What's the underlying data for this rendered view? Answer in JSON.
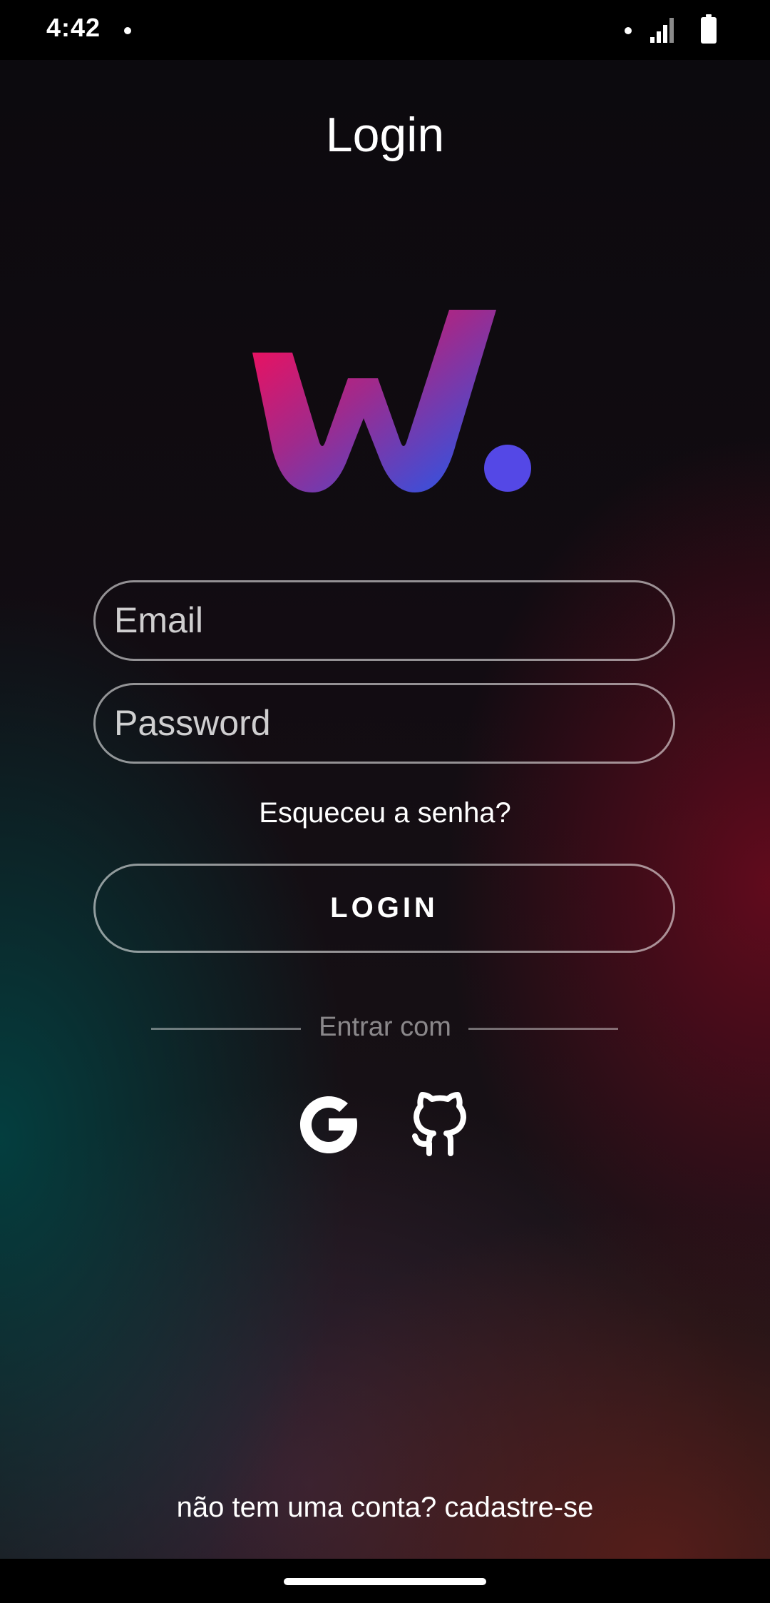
{
  "status_bar": {
    "time": "4:42"
  },
  "header": {
    "title": "Login"
  },
  "logo": {
    "name": "w-logo",
    "gradient_start": "#ff0a54",
    "gradient_end": "#1e5af0",
    "dot_color": "#5448e6"
  },
  "form": {
    "email_placeholder": "Email",
    "password_placeholder": "Password",
    "forgot_label": "Esqueceu a senha?",
    "login_label": "LOGIN"
  },
  "social": {
    "divider_label": "Entrar com",
    "providers": [
      "google-icon",
      "github-icon"
    ]
  },
  "footer": {
    "signup_label": "não tem uma conta? cadastre-se"
  }
}
